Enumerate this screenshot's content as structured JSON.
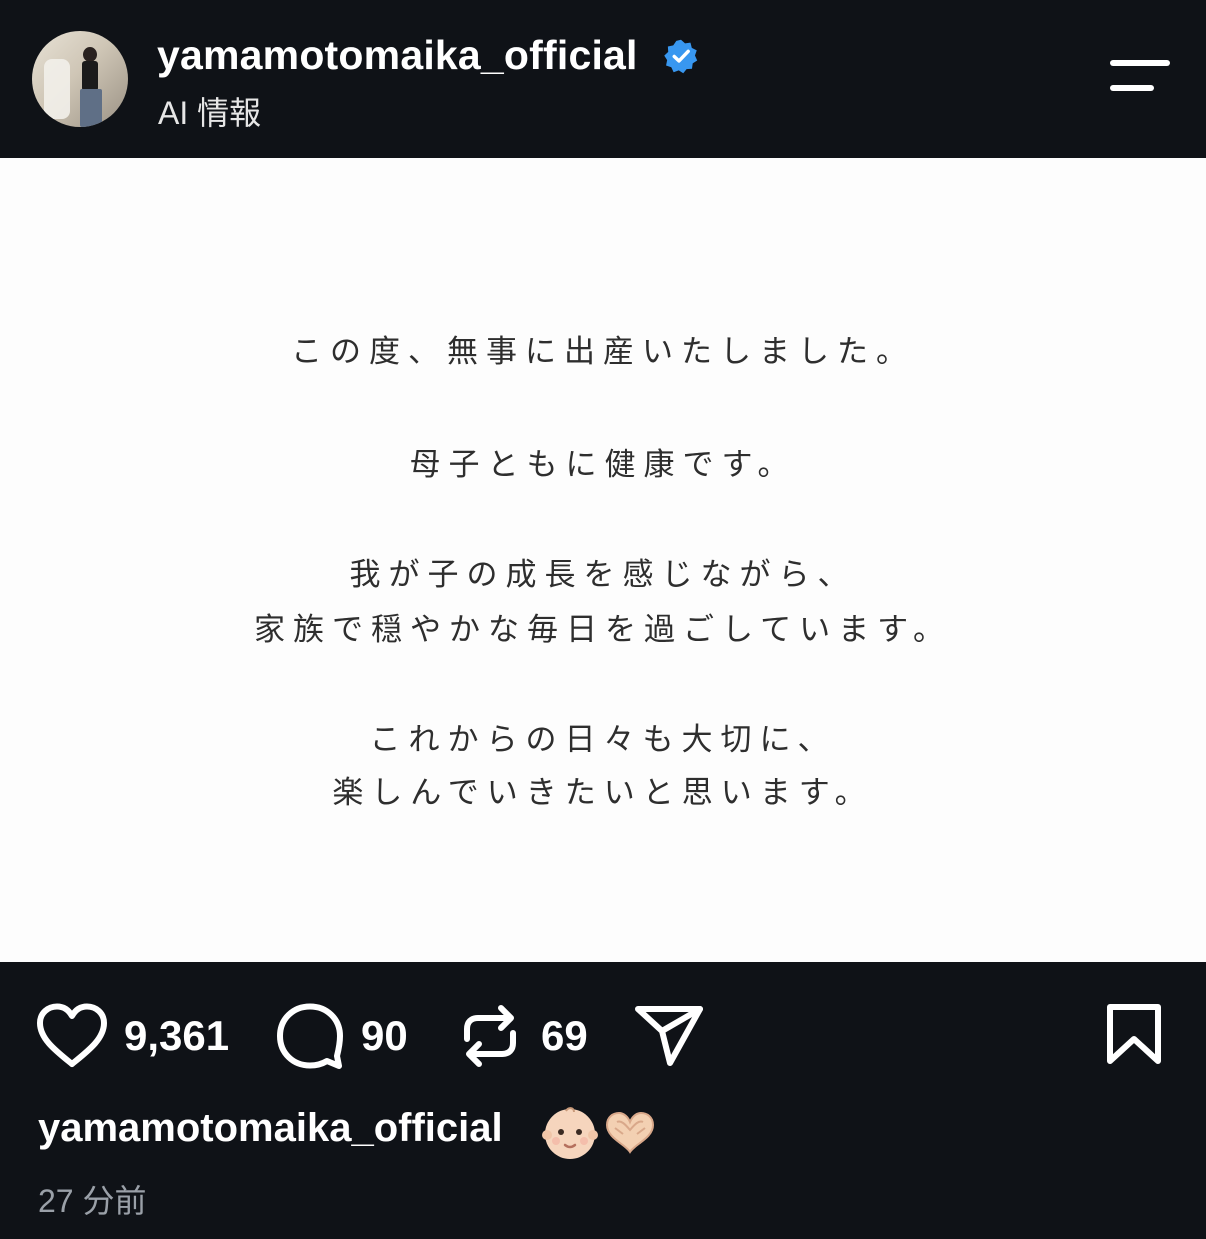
{
  "header": {
    "username": "yamamotomaika_official",
    "verified_icon": "verified-badge-icon",
    "subtitle": "AI 情報",
    "menu_icon": "hamburger-menu-icon"
  },
  "post_image": {
    "lines": [
      "この度、無事に出産いたしました。",
      "母子ともに健康です。",
      "我が子の成長を感じながら、",
      "家族で穏やかな毎日を過ごしています。",
      "これからの日々も大切に、",
      "楽しんでいきたいと思います。"
    ]
  },
  "actions": {
    "likes": "9,361",
    "comments": "90",
    "reposts": "69",
    "icons": [
      "heart-icon",
      "comment-icon",
      "repost-icon",
      "share-icon",
      "bookmark-icon"
    ]
  },
  "caption": {
    "username": "yamamotomaika_official",
    "emojis": [
      "baby-emoji",
      "heart-hands-emoji"
    ]
  },
  "timestamp": "27 分前",
  "colors": {
    "background": "#0f1217",
    "verified": "#3897f0",
    "text": "#ffffff",
    "muted": "#9aa0a8"
  }
}
